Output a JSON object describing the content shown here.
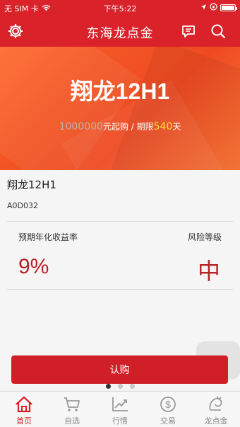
{
  "status_bar": {
    "carrier": "无 SIM 卡",
    "time": "下午5:22"
  },
  "nav": {
    "title": "东海龙点金"
  },
  "banner": {
    "product_title": "翔龙12H1",
    "min_amount": "1000000",
    "min_amount_suffix": "元起购 / 期限",
    "days": "540",
    "days_suffix": "天"
  },
  "product": {
    "name": "翔龙12H1",
    "code": "A0D032",
    "yield_label": "预期年化收益率",
    "yield_value": "9%",
    "risk_label": "风险等级",
    "risk_value": "中"
  },
  "buy_button_label": "认购",
  "pager": {
    "total": 3,
    "active": 1
  },
  "tabs": [
    {
      "label": "首页",
      "icon": "home-icon",
      "active": true
    },
    {
      "label": "自选",
      "icon": "cart-icon",
      "active": false
    },
    {
      "label": "行情",
      "icon": "chart-icon",
      "active": false
    },
    {
      "label": "交易",
      "icon": "dollar-icon",
      "active": false
    },
    {
      "label": "龙点金",
      "icon": "dragon-icon",
      "active": false
    }
  ],
  "colors": {
    "brand_red": "#d9222a",
    "accent_yellow": "#ffe03a",
    "value_red": "#b52224"
  }
}
